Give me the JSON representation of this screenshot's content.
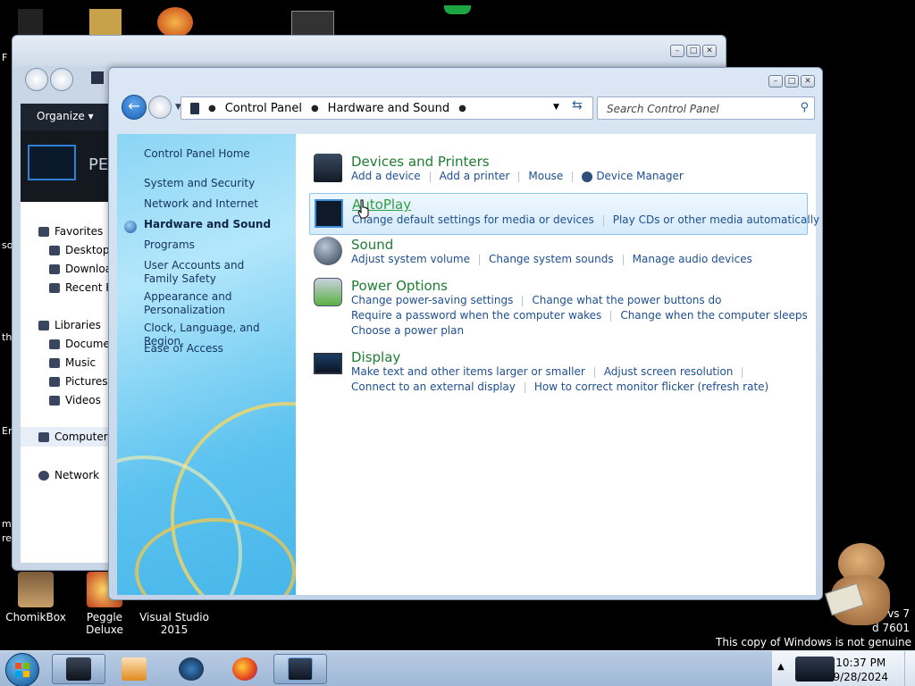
{
  "desktop": {
    "icons": [
      {
        "label": "ChomikBox"
      },
      {
        "label": "Peggle Deluxe"
      },
      {
        "label": "Visual Studio 2015"
      }
    ],
    "watermark": {
      "line1": "vs 7",
      "line2": "d 7601",
      "line3": "This copy of Windows is not genuine"
    },
    "edge_fragments": [
      "F",
      "so",
      "th",
      "Er",
      "m",
      "re"
    ]
  },
  "back_window": {
    "organize_label": "Organize ▾",
    "banner_text": "PE",
    "nav_items": [
      {
        "label": "Favorites"
      },
      {
        "label": "Desktop"
      },
      {
        "label": "Download"
      },
      {
        "label": "Recent Pl"
      },
      {
        "label": "Libraries"
      },
      {
        "label": "Documen"
      },
      {
        "label": "Music"
      },
      {
        "label": "Pictures"
      },
      {
        "label": "Videos"
      },
      {
        "label": "Computer"
      },
      {
        "label": "Network"
      }
    ]
  },
  "window": {
    "address": {
      "segments": [
        "Control Panel",
        "Hardware and Sound"
      ]
    },
    "search_placeholder": "Search Control Panel",
    "sidebar": {
      "items": [
        {
          "label": "Control Panel Home"
        },
        {
          "label": "System and Security"
        },
        {
          "label": "Network and Internet"
        },
        {
          "label": "Hardware and Sound"
        },
        {
          "label": "Programs"
        },
        {
          "label": "User Accounts and Family Safety"
        },
        {
          "label": "Appearance and Personalization"
        },
        {
          "label": "Clock, Language, and Region"
        },
        {
          "label": "Ease of Access"
        }
      ]
    },
    "categories": [
      {
        "title": "Devices and Printers",
        "links": [
          [
            "Add a device",
            "Add a printer",
            "Mouse",
            "Device Manager"
          ]
        ]
      },
      {
        "title": "AutoPlay",
        "links": [
          [
            "Change default settings for media or devices",
            "Play CDs or other media automatically"
          ]
        ]
      },
      {
        "title": "Sound",
        "links": [
          [
            "Adjust system volume",
            "Change system sounds",
            "Manage audio devices"
          ]
        ]
      },
      {
        "title": "Power Options",
        "links": [
          [
            "Change power-saving settings",
            "Change what the power buttons do"
          ],
          [
            "Require a password when the computer wakes",
            "Change when the computer sleeps"
          ],
          [
            "Choose a power plan"
          ]
        ]
      },
      {
        "title": "Display",
        "links": [
          [
            "Make text and other items larger or smaller",
            "Adjust screen resolution"
          ],
          [
            "Connect to an external display",
            "How to correct monitor flicker (refresh rate)"
          ]
        ]
      }
    ]
  },
  "taskbar": {
    "clock_time": "10:37 PM",
    "clock_date": "9/28/2024"
  },
  "colors": {
    "category_title": "#1e7d31",
    "link": "#1d4f91",
    "sidebar_text": "#15325f"
  }
}
